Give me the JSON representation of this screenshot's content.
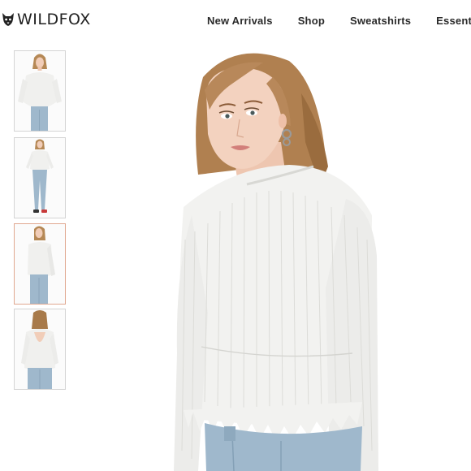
{
  "brand": {
    "name": "WILDFOX",
    "logo_icon": "fox-head-icon"
  },
  "nav": {
    "items": [
      {
        "label": "New Arrivals"
      },
      {
        "label": "Shop"
      },
      {
        "label": "Sweatshirts"
      },
      {
        "label": "Essenti"
      }
    ]
  },
  "gallery": {
    "thumbnails": [
      {
        "view": "front-closeup",
        "active": false
      },
      {
        "view": "full-length",
        "active": false
      },
      {
        "view": "side",
        "active": true
      },
      {
        "view": "back",
        "active": false
      }
    ]
  },
  "colors": {
    "sweater": "#f2f2f0",
    "denim": "#9fb8cc",
    "hair": "#b08050",
    "skin": "#f1cdb8",
    "active_border": "#e0a890"
  }
}
